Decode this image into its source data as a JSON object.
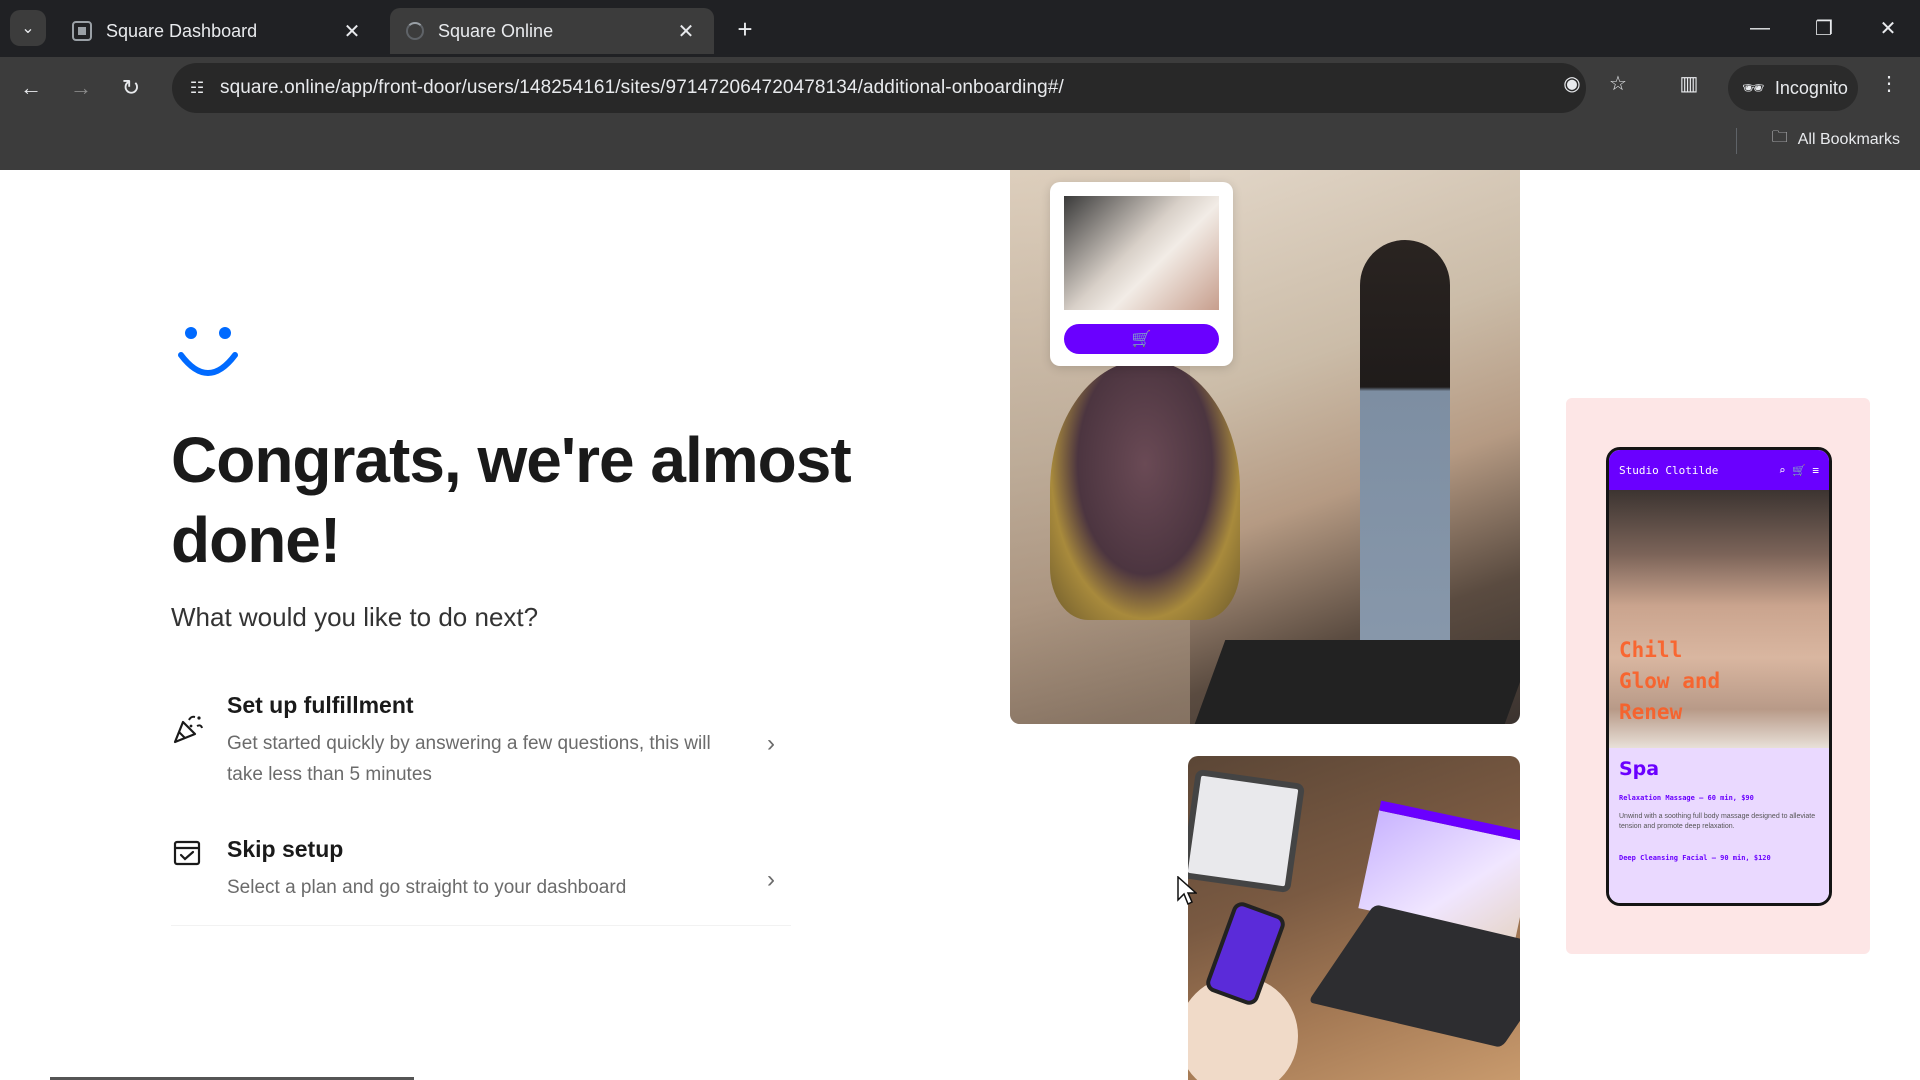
{
  "browser": {
    "tabs": [
      {
        "title": "Square Dashboard",
        "active": false
      },
      {
        "title": "Square Online",
        "active": true
      }
    ],
    "url": "square.online/app/front-door/users/148254161/sites/971472064720478134/additional-onboarding#/",
    "incognito_label": "Incognito",
    "bookmarks_label": "All Bookmarks"
  },
  "page": {
    "heading": "Congrats, we're almost done!",
    "subheading": "What would you like to do next?",
    "options": [
      {
        "title": "Set up fulfillment",
        "description": "Get started quickly by answering a few questions, this will take less than 5 minutes",
        "icon": "party-popper-icon"
      },
      {
        "title": "Skip setup",
        "description": "Select a plan and go straight to your dashboard",
        "icon": "calendar-check-icon"
      }
    ]
  },
  "mockup": {
    "site_name": "Studio Clotilde",
    "hero_text": "Chill\nGlow and\nRenew",
    "section_title": "Spa",
    "service_1": "Relaxation Massage — 60 min, $90",
    "service_1_desc": "Unwind with a soothing full body massage designed to alleviate tension and promote deep relaxation.",
    "service_2": "Deep Cleansing Facial — 90 min, $120"
  },
  "colors": {
    "brand_purple": "#6a00ff",
    "smile_blue": "#006aff",
    "spa_panel": "#fde6e6"
  }
}
